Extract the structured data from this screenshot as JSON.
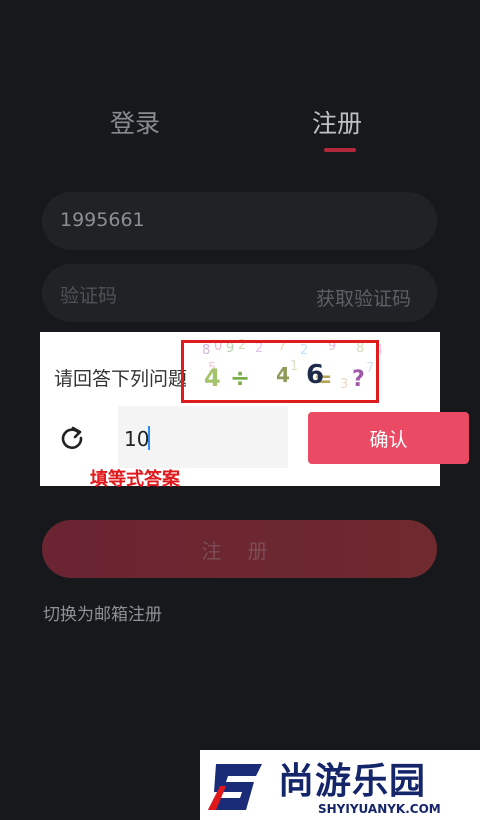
{
  "tabs": {
    "login": "登录",
    "register": "注册"
  },
  "form": {
    "phone_value": "1995661",
    "code_placeholder": "验证码",
    "get_code_label": "获取验证码",
    "register_label": "注 册",
    "switch_email_label": "切换为邮箱注册"
  },
  "dialog": {
    "prompt": "请回答下列问题",
    "captcha_visible_digit": "6",
    "answer_value": "10",
    "confirm_label": "确认"
  },
  "annotation": "填等式答案",
  "watermark": {
    "title": "尚游乐园",
    "domain": "SHYIYUANYK.COM"
  },
  "colors": {
    "background": "#17181c",
    "accent": "#b3273d",
    "confirm": "#ea4a63",
    "annotation": "#e0171b"
  },
  "icons": {
    "refresh": "refresh-icon",
    "logo": "s-logo"
  }
}
